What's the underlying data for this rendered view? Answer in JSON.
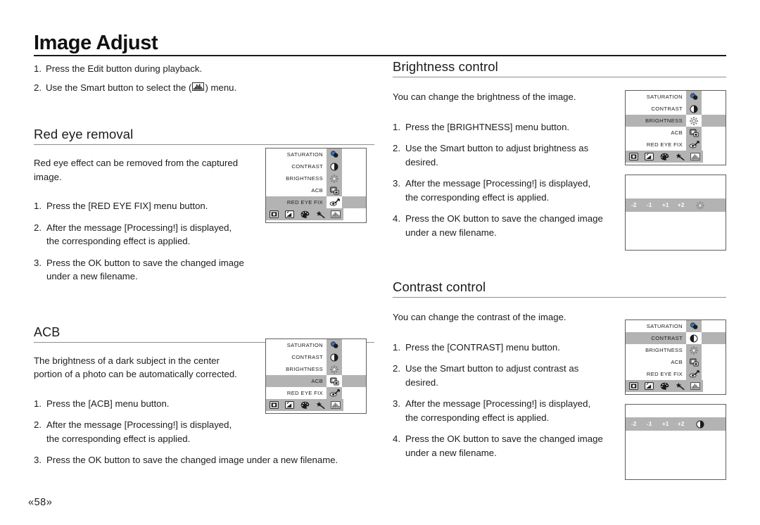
{
  "page": {
    "title": "Image Adjust",
    "folio": "«58»"
  },
  "intro": {
    "items": [
      {
        "num": "1.",
        "pre": "Press the Edit button during playback.",
        "post": ""
      },
      {
        "num": "2.",
        "pre": "Use the Smart button to select the (",
        "post": ") menu.",
        "icon": "histogram-icon"
      }
    ]
  },
  "sections": {
    "red_eye": {
      "heading": "Red eye removal",
      "para_line1": "Red eye effect can be removed from the captured",
      "para_line2": "image.",
      "steps": [
        {
          "num": "1.",
          "line1": "Press the [RED EYE FIX] menu button.",
          "line2": ""
        },
        {
          "num": "2.",
          "line1": "After the message [Processing!] is displayed,",
          "line2": "the corresponding effect is applied."
        },
        {
          "num": "3.",
          "line1": "Press the OK button to save the changed image",
          "line2": "under a new filename."
        }
      ]
    },
    "acb": {
      "heading": "ACB",
      "para_line1": "The brightness of a dark subject in the center",
      "para_line2": "portion of a photo can be automatically corrected.",
      "steps": [
        {
          "num": "1.",
          "line1": "Press the [ACB] menu button.",
          "line2": ""
        },
        {
          "num": "2.",
          "line1": "After the message [Processing!] is displayed,",
          "line2": "the corresponding effect is applied."
        },
        {
          "num": "3.",
          "line1": "Press the OK button to save the changed image under a new filename.",
          "line2": ""
        }
      ]
    },
    "brightness": {
      "heading": "Brightness control",
      "para_line1": "You can change the brightness of the image.",
      "steps": [
        {
          "num": "1.",
          "line1": "Press the [BRIGHTNESS] menu button.",
          "line2": ""
        },
        {
          "num": "2.",
          "line1": "Use the Smart button to adjust brightness as",
          "line2": "desired."
        },
        {
          "num": "3.",
          "line1": "After the message [Processing!] is displayed,",
          "line2": "the corresponding effect is applied."
        },
        {
          "num": "4.",
          "line1": "Press the OK button to save the changed image",
          "line2": "under a new filename."
        }
      ]
    },
    "contrast": {
      "heading": "Contrast control",
      "para_line1": "You can change the contrast of the image.",
      "steps": [
        {
          "num": "1.",
          "line1": "Press the [CONTRAST] menu button.",
          "line2": ""
        },
        {
          "num": "2.",
          "line1": "Use the Smart button to adjust contrast as",
          "line2": "desired."
        },
        {
          "num": "3.",
          "line1": "After the message [Processing!] is displayed,",
          "line2": "the corresponding effect is applied."
        },
        {
          "num": "4.",
          "line1": "Press the OK button to save the changed image",
          "line2": "under a new filename."
        }
      ]
    }
  },
  "lcd_menu": {
    "rows": [
      {
        "label": "SATURATION",
        "icon": "saturation-icon"
      },
      {
        "label": "CONTRAST",
        "icon": "contrast-icon"
      },
      {
        "label": "BRIGHTNESS",
        "icon": "brightness-icon"
      },
      {
        "label": "ACB",
        "icon": "acb-icon"
      },
      {
        "label": "RED EYE FIX",
        "icon": "red-eye-fix-icon"
      }
    ],
    "toolbar": [
      {
        "icon": "resize-icon"
      },
      {
        "icon": "rotate-icon"
      },
      {
        "icon": "palette-icon"
      },
      {
        "icon": "effect-wand-icon"
      },
      {
        "icon": "histogram-icon"
      }
    ],
    "selected": {
      "red_eye_panel": "RED EYE FIX",
      "acb_panel": "ACB",
      "brightness_panel": "BRIGHTNESS",
      "contrast_panel": "CONTRAST"
    },
    "toolbar_active": "histogram-icon"
  },
  "scale": {
    "values": [
      "-2",
      "-1",
      "+1",
      "+2"
    ],
    "brightness_icon": "brightness-icon",
    "contrast_icon": "contrast-icon"
  },
  "colors": {
    "highlight": "#b3b3b3",
    "panel_border": "#5f5f5f",
    "rule": "#8e8e8e",
    "text": "#1c1c1c"
  }
}
